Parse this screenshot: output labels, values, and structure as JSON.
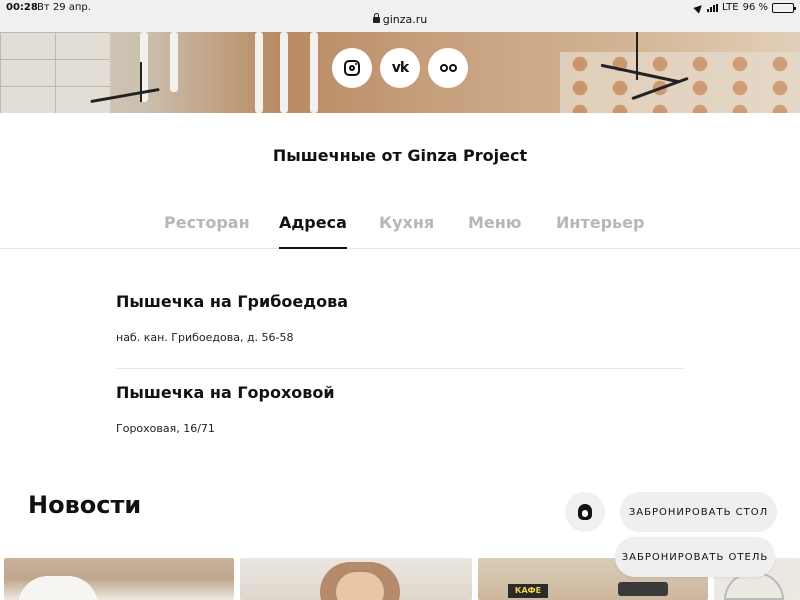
{
  "status_bar": {
    "time": "00:28",
    "date": "Вт 29 апр.",
    "url": "ginza.ru",
    "network": "LTE",
    "battery": "96 %",
    "battery_level": 0.96
  },
  "hero": {
    "social": [
      {
        "icon": "instagram-icon"
      },
      {
        "icon": "vk-icon",
        "glyph": "vk"
      },
      {
        "icon": "tripadvisor-icon"
      }
    ]
  },
  "page": {
    "title": "Пышечные от Ginza Project"
  },
  "tabs": [
    {
      "label": "Ресторан",
      "active": false
    },
    {
      "label": "Адреса",
      "active": true
    },
    {
      "label": "Кухня",
      "active": false
    },
    {
      "label": "Меню",
      "active": false
    },
    {
      "label": "Интерьер",
      "active": false
    }
  ],
  "addresses": [
    {
      "name": "Пышечка на Грибоедова",
      "street": "наб. кан. Грибоедова, д. 56-58"
    },
    {
      "name": "Пышечка на Гороховой",
      "street": "Гороховая, 16/71"
    }
  ],
  "news": {
    "title": "Новости",
    "book_table": "ЗАБРОНИРОВАТЬ СТОЛ",
    "book_hotel": "ЗАБРОНИРОВАТЬ ОТЕЛЬ",
    "card3_sign": "КАФЕ"
  },
  "colors": {
    "accent": "#111111",
    "tab_inactive": "#b7b7b7",
    "pill_bg": "#efefef"
  }
}
